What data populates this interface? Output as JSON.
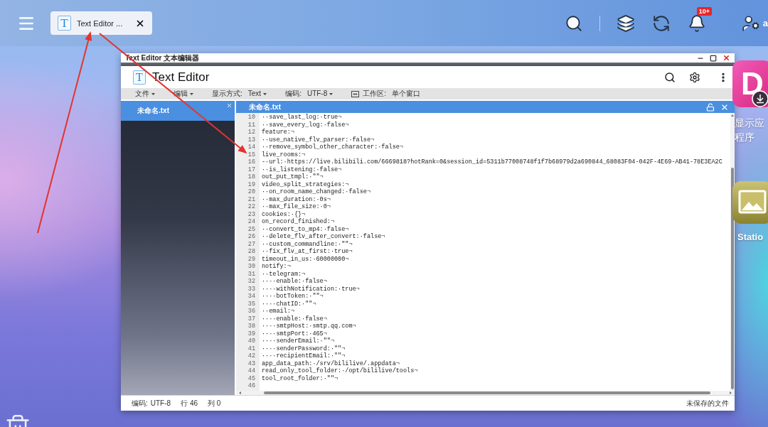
{
  "top_bar": {
    "tabs": [
      {
        "label": "Text Editor ...",
        "logo_letter": "T",
        "selected": true
      }
    ],
    "notification_badge": "10+",
    "user_name": "a"
  },
  "window": {
    "title": "Text Editor 文本编辑器",
    "app_name": "Text Editor",
    "logo_letter": "T",
    "toolbar": [
      {
        "kind": "menu",
        "label": "文件"
      },
      {
        "kind": "menu",
        "label": "编辑"
      },
      {
        "kind": "select",
        "label": "显示方式:",
        "value": "Text"
      },
      {
        "kind": "select",
        "label": "编码:",
        "value": "UTF-8"
      },
      {
        "kind": "info",
        "label": "工作区:",
        "value": "单个窗口"
      }
    ],
    "files": [
      {
        "name": "未命名.txt",
        "selected": true
      }
    ],
    "editor": {
      "tabs": [
        {
          "name": "未命名.txt",
          "selected": true,
          "locked": false
        }
      ],
      "lines": [
        {
          "number": "10",
          "text": "··save_last_log:·true¬"
        },
        {
          "number": "11",
          "text": "··save_every_log:·false¬"
        },
        {
          "number": "12",
          "text": "feature:¬"
        },
        {
          "number": "13",
          "text": "··use_native_flv_parser:·false¬"
        },
        {
          "number": "14",
          "text": "··remove_symbol_other_character:·false¬"
        },
        {
          "number": "15",
          "text": "live_rooms:¬"
        },
        {
          "number": "16",
          "text": "-·url:·https://live.bilibili.com/6669818?hotRank=0&session_id=5311b77008748f1f7b68979d2a690844_68083F04-042F-4E69-AB41-78E3EA2C"
        },
        {
          "number": "17",
          "text": "··is_listening:·false¬"
        },
        {
          "number": "18",
          "text": "out_put_tmpl:·\"\"¬"
        },
        {
          "number": "19",
          "text": "video_split_strategies:¬"
        },
        {
          "number": "20",
          "text": "··on_room_name_changed:·false¬"
        },
        {
          "number": "21",
          "text": "··max_duration:·0s¬"
        },
        {
          "number": "22",
          "text": "··max_file_size:·0¬"
        },
        {
          "number": "23",
          "text": "cookies:·{}¬"
        },
        {
          "number": "24",
          "text": "on_record_finished:¬"
        },
        {
          "number": "25",
          "text": "··convert_to_mp4:·false¬"
        },
        {
          "number": "26",
          "text": "··delete_flv_after_convert:·false¬"
        },
        {
          "number": "27",
          "text": "··custom_commandline:·\"\"¬"
        },
        {
          "number": "28",
          "text": "··fix_flv_at_first:·true¬"
        },
        {
          "number": "29",
          "text": "timeout_in_us:·60000000¬"
        },
        {
          "number": "30",
          "text": "notify:¬"
        },
        {
          "number": "31",
          "text": "··telegram:¬"
        },
        {
          "number": "32",
          "text": "····enable:·false¬"
        },
        {
          "number": "33",
          "text": "····withNotification:·true¬"
        },
        {
          "number": "34",
          "text": "····botToken:·\"\"¬"
        },
        {
          "number": "35",
          "text": "····chatID:·\"\"¬"
        },
        {
          "number": "36",
          "text": "··email:¬"
        },
        {
          "number": "37",
          "text": "····enable:·false¬"
        },
        {
          "number": "38",
          "text": "····smtpHost:·smtp.qq.com¬"
        },
        {
          "number": "39",
          "text": "····smtpPort:·465¬"
        },
        {
          "number": "40",
          "text": "····senderEmail:·\"\"¬"
        },
        {
          "number": "41",
          "text": "····senderPassword:·\"\"¬"
        },
        {
          "number": "42",
          "text": "····recipientEmail:·\"\"¬"
        },
        {
          "number": "43",
          "text": "app_data_path:·/srv/bililive/.appdata¬"
        },
        {
          "number": "44",
          "text": "read_only_tool_folder:·/opt/bililive/tools¬"
        },
        {
          "number": "45",
          "text": "tool_root_folder:·\"\"¬"
        },
        {
          "number": "46"
        }
      ]
    },
    "status_bar": {
      "encoding_label": "编码:",
      "encoding": "UTF-8",
      "line": "行 46",
      "column": "列 0",
      "file_state": "未保存的文件"
    }
  },
  "desktop_icons": [
    {
      "kind": "store",
      "glyph": "D",
      "label": [
        "显示应",
        "程序"
      ]
    },
    {
      "kind": "photo",
      "label": [
        "Statio"
      ]
    }
  ]
}
